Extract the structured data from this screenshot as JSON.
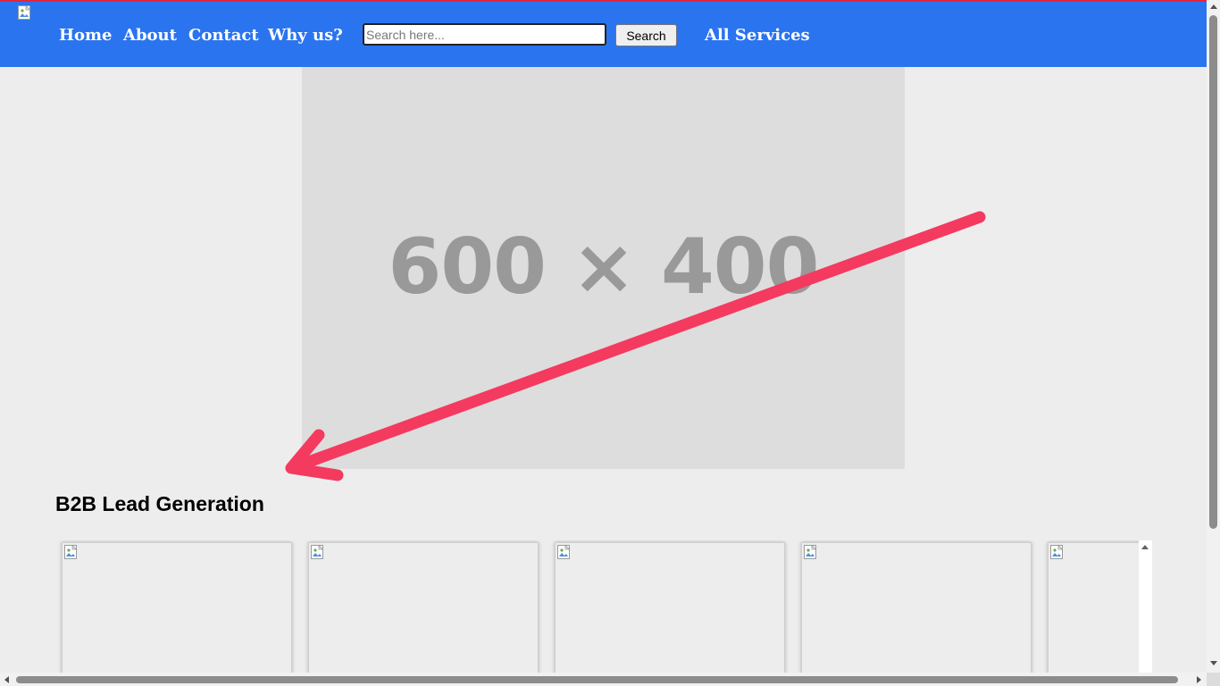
{
  "nav": {
    "logo_icon": "broken-image-icon",
    "links": [
      "Home",
      "About",
      "Contact",
      "Why us?"
    ],
    "search_placeholder": "Search here...",
    "search_button": "Search",
    "all_services": "All Services"
  },
  "hero": {
    "placeholder_text": "600 × 400"
  },
  "section": {
    "title": "B2B Lead Generation",
    "card_icon": "broken-image-icon"
  },
  "colors": {
    "nav_background": "#2b74ef",
    "top_border": "#e8233a",
    "arrow": "#f43a5f",
    "page_background": "#ededed",
    "hero_background": "#dddddd"
  }
}
